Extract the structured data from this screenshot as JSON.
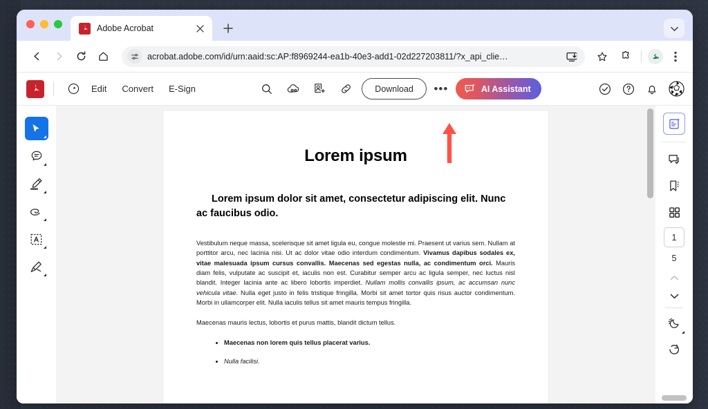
{
  "browser": {
    "traffic_lights": [
      "close",
      "minimize",
      "zoom"
    ],
    "tab": {
      "title": "Adobe Acrobat",
      "favicon": "adobe-acrobat-icon",
      "close_label": "×"
    },
    "new_tab_label": "+",
    "nav": {
      "back": "back-arrow",
      "forward": "forward-arrow",
      "reload": "reload-icon",
      "home": "home-icon"
    },
    "omnibox": {
      "site_settings_icon": "site-settings-icon",
      "url": "acrobat.adobe.com/id/urn:aaid:sc:AP:f8969244-ea1b-40e3-add1-02d227203811/?x_api_clie…",
      "install_icon": "install-app-icon",
      "bookmark_icon": "star-icon"
    },
    "controls": {
      "extensions_icon": "extensions-puzzle-icon",
      "profile_icon": "profile-avatar",
      "menu_icon": "three-dot-menu-icon",
      "tab_list_icon": "chevron-down-icon"
    }
  },
  "acrobat": {
    "logo": "adobe-acrobat-logo",
    "history_icon": "recent-history-icon",
    "menus": [
      {
        "label": "Edit",
        "name": "edit"
      },
      {
        "label": "Convert",
        "name": "convert"
      },
      {
        "label": "E-Sign",
        "name": "e-sign"
      }
    ],
    "center_tools": [
      {
        "name": "search-icon"
      },
      {
        "name": "share-cloud-icon"
      },
      {
        "name": "invite-people-icon"
      },
      {
        "name": "link-icon"
      }
    ],
    "download_label": "Download",
    "more_label": "•••",
    "ai_assistant_label": "AI Assistant",
    "ai_assistant_icon": "ai-chat-sparkle-icon",
    "right_tools": [
      {
        "name": "check-circle-icon"
      },
      {
        "name": "help-question-icon"
      },
      {
        "name": "notification-bell-icon"
      },
      {
        "name": "globe-avatar-icon"
      }
    ],
    "left_rail": [
      {
        "name": "select-cursor-tool",
        "active": true
      },
      {
        "name": "comment-bubble-tool",
        "active": false
      },
      {
        "name": "highlighter-pen-tool",
        "active": false
      },
      {
        "name": "draw-lasso-tool",
        "active": false
      },
      {
        "name": "add-text-box-tool",
        "active": false
      },
      {
        "name": "signature-tool",
        "active": false
      }
    ],
    "right_rail": {
      "top_tools": [
        {
          "name": "ai-summary-panel",
          "active": true
        }
      ],
      "panel_tools": [
        {
          "name": "comments-panel"
        },
        {
          "name": "bookmarks-panel"
        },
        {
          "name": "page-thumbnails-panel"
        }
      ],
      "current_page": "1",
      "total_pages": "5",
      "prev_page_icon": "chevron-up-icon",
      "next_page_icon": "chevron-down-icon",
      "appearance_icon": "dark-mode-moon-icon",
      "rotate_icon": "rotate-clockwise-icon"
    }
  },
  "document": {
    "title": "Lorem ipsum",
    "subtitle": "Lorem ipsum dolor sit amet, consectetur adipiscing elit. Nunc ac faucibus odio.",
    "paragraph1_part1": "Vestibulum neque massa, scelerisque sit amet ligula eu, congue molestie mi. Praesent ut varius sem. Nullam at porttitor arcu, nec lacinia nisi. Ut ac dolor vitae odio interdum condimentum. ",
    "paragraph1_bold": "Vivamus dapibus sodales ex, vitae malesuada ipsum cursus convallis. Maecenas sed egestas nulla, ac condimentum orci.",
    "paragraph1_part2": " Mauris diam felis, vulputate ac suscipit et, iaculis non est. Curabitur semper arcu ac ligula semper, nec luctus nisl blandit. Integer lacinia ante ac libero lobortis imperdiet. ",
    "paragraph1_italic": "Nullam mollis convallis ipsum, ac accumsan nunc vehicula vitae.",
    "paragraph1_part3": " Nulla eget justo in felis tristique fringilla. Morbi sit amet tortor quis risus auctor condimentum. Morbi in ullamcorper elit. Nulla iaculis tellus sit amet mauris tempus fringilla.",
    "paragraph2": "Maecenas mauris lectus, lobortis et purus mattis, blandit dictum tellus.",
    "bullet1": "Maecenas non lorem quis tellus placerat varius.",
    "bullet2": "Nulla facilisi."
  },
  "annotation": {
    "arrow": "red-up-arrow-pointing-to-download",
    "color": "#ff5347"
  },
  "colors": {
    "accent_blue": "#1473e6",
    "adobe_red": "#c8232c",
    "ai_gradient_start": "#ec5b53",
    "ai_gradient_end": "#5a5fe0",
    "annotation_red": "#ff5347",
    "desktop_bg": "#2e3542",
    "tab_strip_bg": "#dde3f8"
  }
}
